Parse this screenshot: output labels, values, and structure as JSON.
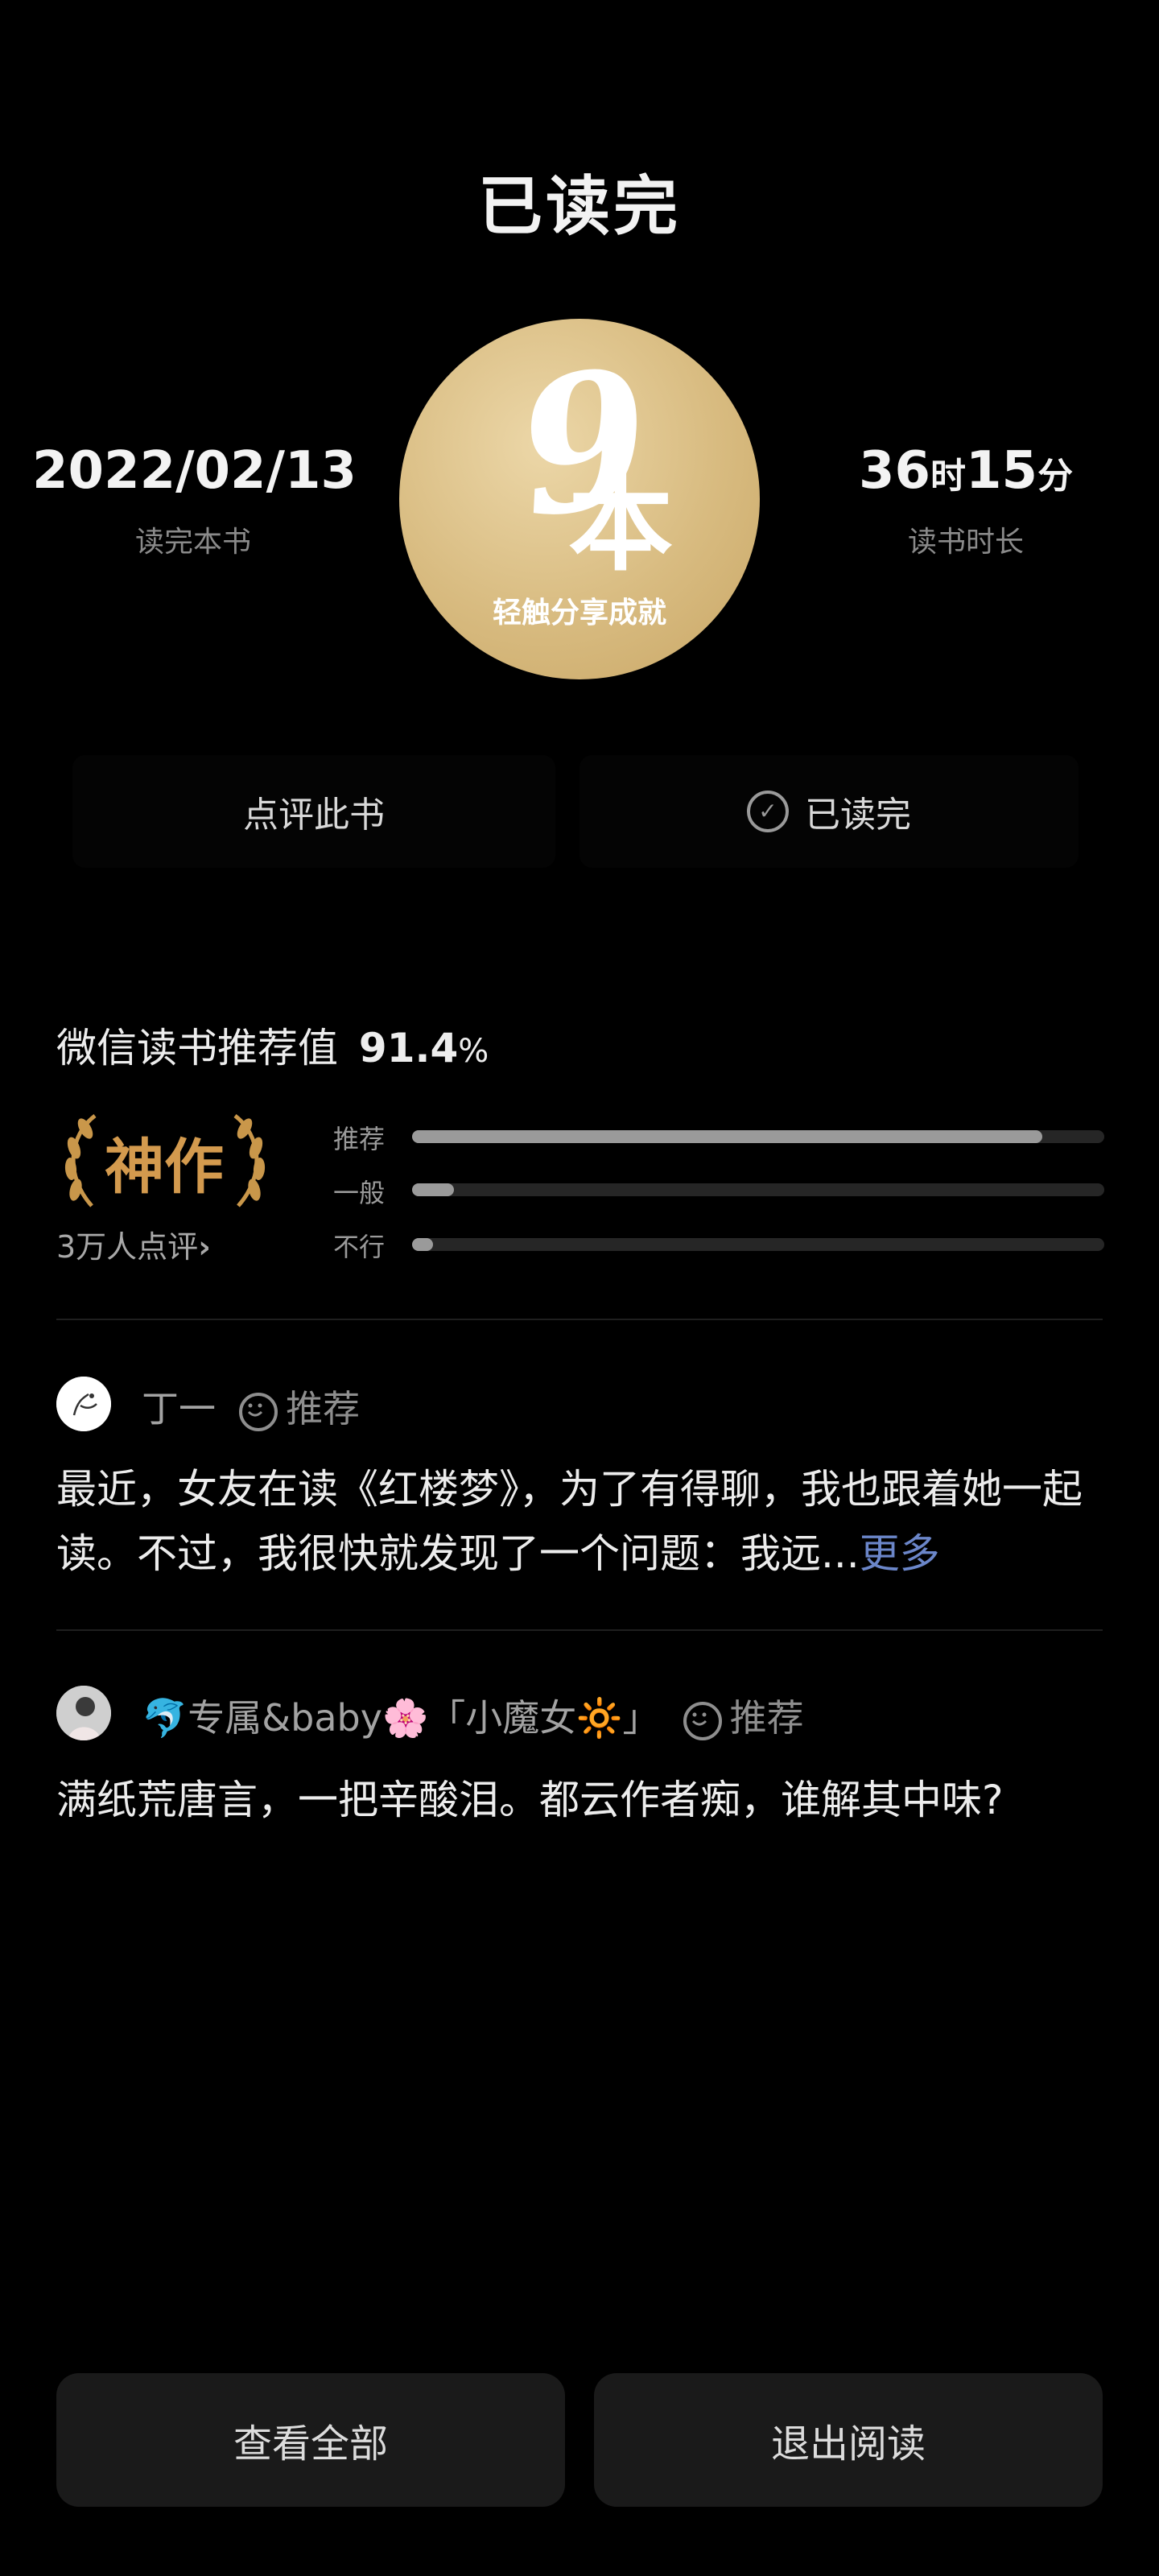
{
  "header": {
    "title": "已读完"
  },
  "stats": {
    "finish_date": "2022/02/13",
    "finish_date_label": "读完本书",
    "hours": "36",
    "hours_unit": "时",
    "minutes": "15",
    "minutes_unit": "分",
    "duration_label": "读书时长"
  },
  "achievement": {
    "count": "9",
    "count_unit": "本",
    "share_label": "轻触分享成就"
  },
  "actions": {
    "review_label": "点评此书",
    "finished_label": "已读完"
  },
  "recommendation": {
    "title_prefix": "微信读书推荐值",
    "value": "91.4",
    "percent_sign": "%",
    "rating_badge": "神作",
    "reviews_count_label": "3万人点评",
    "bars": [
      {
        "label": "推荐",
        "fraction": 0.91
      },
      {
        "label": "一般",
        "fraction": 0.06
      },
      {
        "label": "不行",
        "fraction": 0.03
      }
    ]
  },
  "reviews": [
    {
      "user": "丁一",
      "tag": "推荐",
      "text": "最近，女友在读《红楼梦》，为了有得聊，我也跟着她一起读。不过，我很快就发现了一个问题：我远...",
      "more": "更多"
    },
    {
      "user": "🐬专属&baby🌸「小魔女🔆」",
      "tag": "推荐",
      "text": "满纸荒唐言，一把辛酸泪。都云作者痴，谁解其中味?"
    }
  ],
  "bottom": {
    "view_all_label": "查看全部",
    "exit_label": "退出阅读"
  },
  "colors": {
    "background": "#000000",
    "gold_badge": "#d8bb80",
    "laurel_gold": "#c9974a",
    "link_blue": "#6b86c9"
  },
  "icons": [
    "check-circle-icon",
    "smile-icon",
    "laurel-icon",
    "chevron-right-icon"
  ]
}
